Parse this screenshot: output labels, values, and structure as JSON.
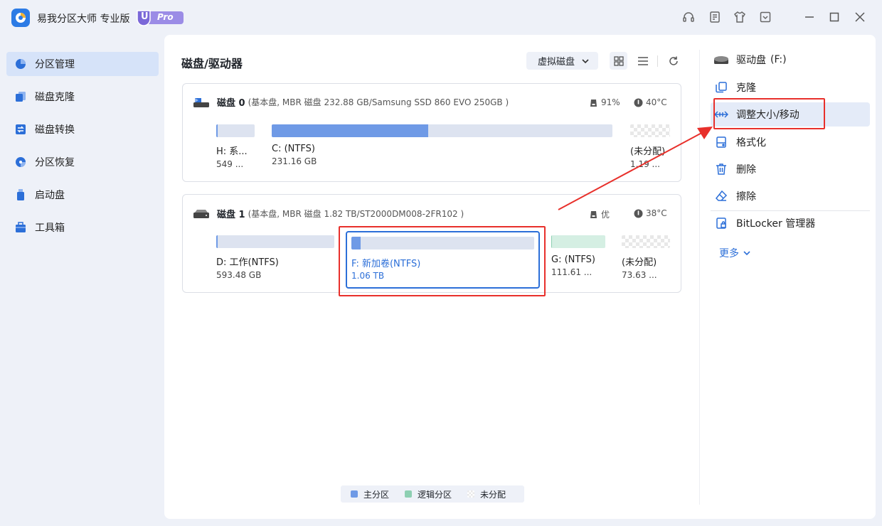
{
  "app": {
    "title": "易我分区大师 专业版",
    "badge_letter": "U",
    "badge_text": "Pro"
  },
  "titlebar_icons": [
    "headset-icon",
    "notes-icon",
    "shirt-icon",
    "dropdown-box-icon",
    "minimize-icon",
    "maximize-icon",
    "close-icon"
  ],
  "sidebar": {
    "items": [
      {
        "label": "分区管理",
        "icon": "pie-chart-icon",
        "active": true
      },
      {
        "label": "磁盘克隆",
        "icon": "clone-icon",
        "active": false
      },
      {
        "label": "磁盘转换",
        "icon": "convert-icon",
        "active": false
      },
      {
        "label": "分区恢复",
        "icon": "recover-icon",
        "active": false
      },
      {
        "label": "启动盘",
        "icon": "usb-icon",
        "active": false
      },
      {
        "label": "工具箱",
        "icon": "toolbox-icon",
        "active": false
      }
    ]
  },
  "main": {
    "title": "磁盘/驱动器",
    "virtual_disk": "虚拟磁盘",
    "disks": [
      {
        "name": "磁盘 0",
        "details": "(基本盘, MBR 磁盘 232.88 GB/Samsung SSD 860 EVO 250GB )",
        "health": "91%",
        "temp": "40°C",
        "partitions": [
          {
            "name": "H: 系...",
            "size": "549 ...",
            "type": "primary",
            "used": 0.03
          },
          {
            "name": "C: (NTFS)",
            "size": "231.16 GB",
            "type": "primary",
            "used": 0.46
          },
          {
            "name": "(未分配)",
            "size": "1.19 ...",
            "type": "unallocated",
            "used": 0
          }
        ]
      },
      {
        "name": "磁盘 1",
        "details": "(基本盘, MBR 磁盘 1.82 TB/ST2000DM008-2FR102 )",
        "health": "优",
        "temp": "38°C",
        "partitions": [
          {
            "name": "D: 工作(NTFS)",
            "size": "593.48 GB",
            "type": "primary",
            "used": 0.01
          },
          {
            "name": "F: 新加卷(NTFS)",
            "size": "1.06 TB",
            "type": "primary",
            "used": 0.05,
            "selected": true
          },
          {
            "name": "G: (NTFS)",
            "size": "111.61 ...",
            "type": "logical",
            "used": 0.01
          },
          {
            "name": "(未分配)",
            "size": "73.63 ...",
            "type": "unallocated",
            "used": 0
          }
        ]
      }
    ],
    "legend": [
      {
        "label": "主分区",
        "color": "#6f9ae6"
      },
      {
        "label": "逻辑分区",
        "color": "#8dcfb2"
      },
      {
        "label": "未分配",
        "color": "checker"
      }
    ]
  },
  "right_panel": {
    "drive_label": "驱动盘",
    "drive_letter": "(F:)",
    "actions": [
      {
        "label": "克隆",
        "icon": "copy-icon"
      },
      {
        "label": "调整大小/移动",
        "icon": "resize-arrows-icon",
        "highlighted": true
      },
      {
        "label": "格式化",
        "icon": "format-icon"
      },
      {
        "label": "删除",
        "icon": "trash-icon"
      },
      {
        "label": "擦除",
        "icon": "eraser-icon"
      },
      {
        "label": "BitLocker 管理器",
        "icon": "bitlocker-icon"
      }
    ],
    "more": "更多"
  },
  "colors": {
    "accent": "#2c6fd8",
    "primary_partition": "#6f9ae6",
    "logical_partition": "#8dcfb2",
    "annotation_red": "#e8302b"
  }
}
